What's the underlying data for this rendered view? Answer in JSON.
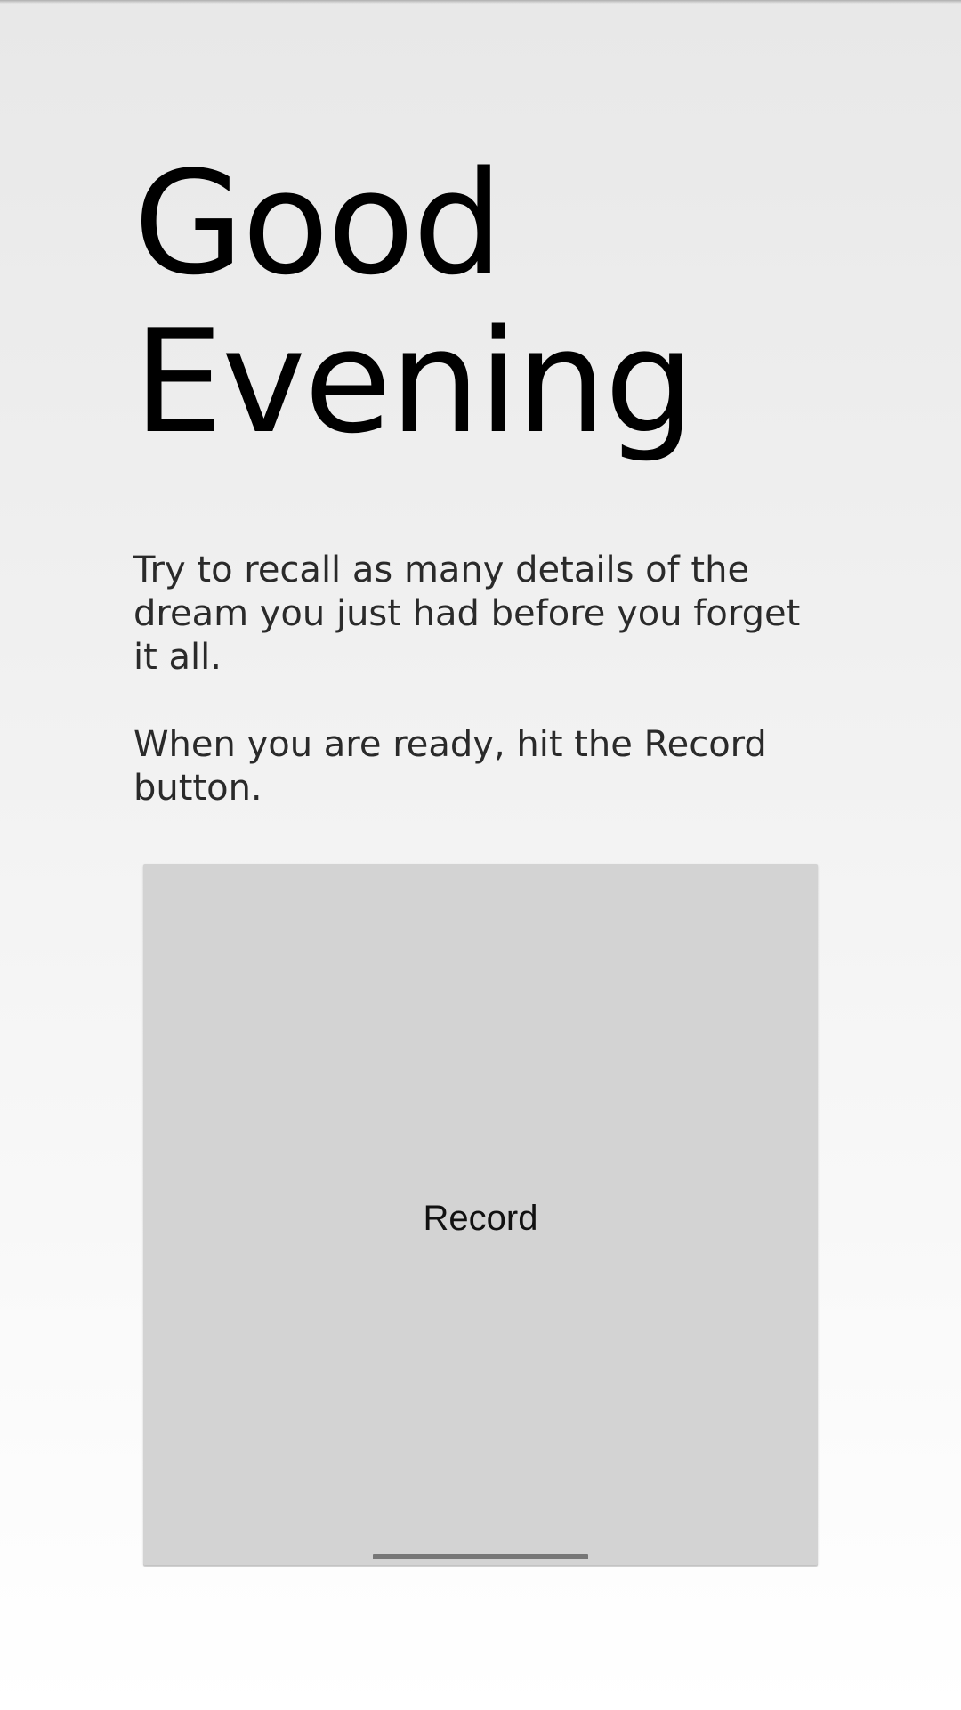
{
  "greeting": {
    "line1": "Good",
    "line2": "Evening"
  },
  "instructions": {
    "paragraph1": "Try to recall as many details of the dream you just had before you forget it all.",
    "paragraph2": "When you are ready, hit the Record button."
  },
  "record_button": {
    "label": "Record"
  },
  "colors": {
    "background_top": "#e8e8e8",
    "background_bottom": "#ffffff",
    "button_background": "#d3d3d3",
    "button_indicator": "#777777",
    "heading_text": "#000000",
    "body_text": "#2a2a2a"
  }
}
